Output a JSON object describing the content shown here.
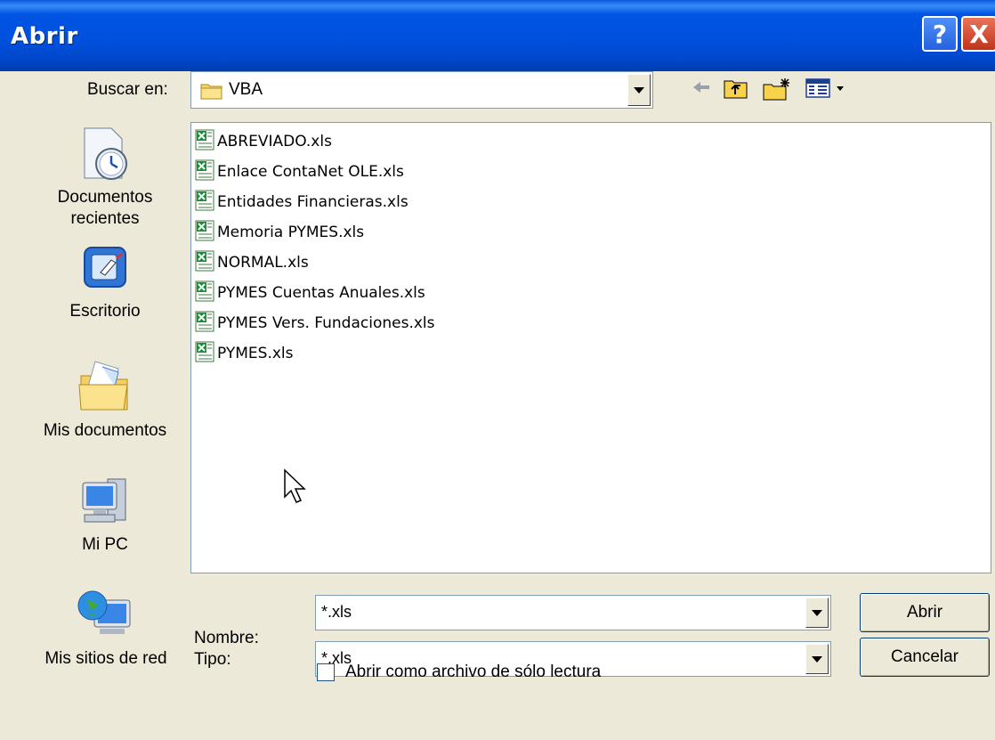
{
  "window": {
    "title": "Abrir",
    "help_symbol": "?",
    "close_symbol": "X"
  },
  "lookin": {
    "label": "Buscar en:",
    "value": "VBA"
  },
  "places": [
    {
      "label_line1": "Documentos",
      "label_line2": "recientes"
    },
    {
      "label_line1": "Escritorio"
    },
    {
      "label_line1": "Mis documentos"
    },
    {
      "label_line1": "Mi PC"
    },
    {
      "label_line1": "Mis sitios de red"
    }
  ],
  "files": [
    "ABREVIADO.xls",
    "Enlace ContaNet OLE.xls",
    "Entidades Financieras.xls",
    "Memoria PYMES.xls",
    "NORMAL.xls",
    "PYMES Cuentas Anuales.xls",
    "PYMES Vers. Fundaciones.xls",
    "PYMES.xls"
  ],
  "filename": {
    "label": "Nombre:",
    "value": "*.xls"
  },
  "filetype": {
    "label": "Tipo:",
    "value": "*.xls"
  },
  "buttons": {
    "open": "Abrir",
    "cancel": "Cancelar"
  },
  "readonly": {
    "label": "Abrir como archivo de sólo lectura",
    "checked": false
  },
  "icons": {
    "back": "back-arrow-icon",
    "up": "up-folder-icon",
    "newfolder": "new-folder-icon",
    "views": "views-menu-icon"
  }
}
